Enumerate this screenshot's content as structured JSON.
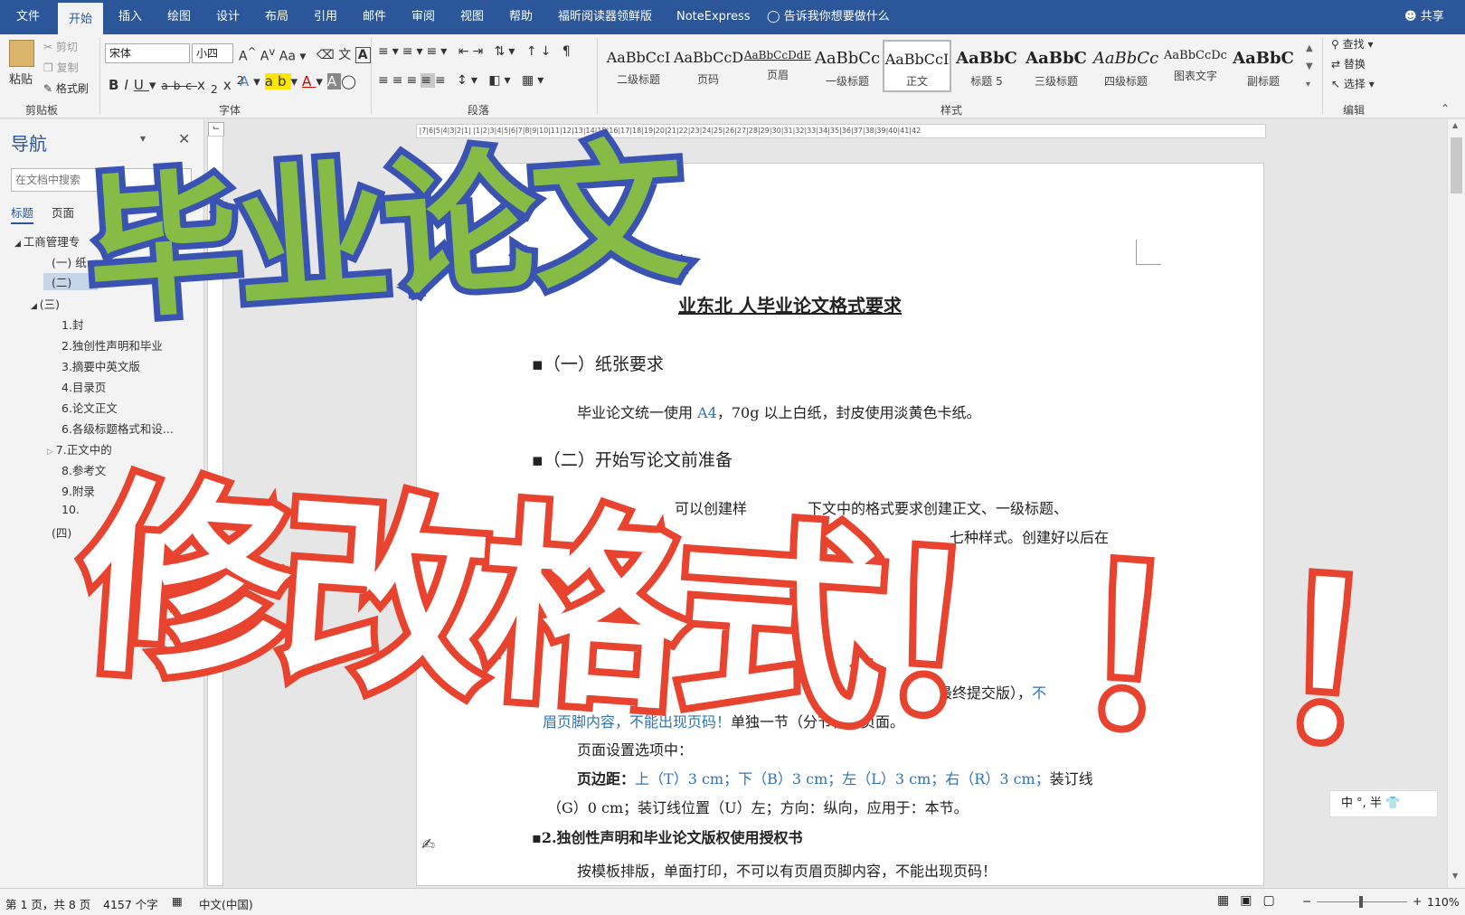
{
  "menubar": {
    "tabs": [
      "文件",
      "开始",
      "插入",
      "绘图",
      "设计",
      "布局",
      "引用",
      "邮件",
      "审阅",
      "视图",
      "帮助",
      "福昕阅读器领鲜版",
      "NoteExpress"
    ],
    "active_tab": "开始",
    "tell_me": "告诉我你想要做什么",
    "share": "共享"
  },
  "ribbon": {
    "clipboard": {
      "paste": "粘贴",
      "cut": "剪切",
      "copy": "复制",
      "format_painter": "格式刷",
      "group": "剪贴板"
    },
    "font": {
      "name": "宋体",
      "size": "小四",
      "group": "字体"
    },
    "paragraph": {
      "group": "段落"
    },
    "styles": {
      "group": "样式",
      "items": [
        {
          "sample": "AaBbCcI",
          "label": "二级标题"
        },
        {
          "sample": "AaBbCcD",
          "label": "页码"
        },
        {
          "sample": "AaBbCcDdE",
          "label": "页眉"
        },
        {
          "sample": "AaBbCc",
          "label": "一级标题"
        },
        {
          "sample": "AaBbCcI",
          "label": "正文"
        },
        {
          "sample": "AaBbC",
          "label": "标题 5"
        },
        {
          "sample": "AaBbC",
          "label": "三级标题"
        },
        {
          "sample": "AaBbCc",
          "label": "四级标题"
        },
        {
          "sample": "AaBbCcDc",
          "label": "图表文字"
        },
        {
          "sample": "AaBbC",
          "label": "副标题"
        }
      ],
      "selected": "正文"
    },
    "editing": {
      "find": "查找",
      "replace": "替换",
      "select": "选择",
      "group": "编辑"
    }
  },
  "nav": {
    "title": "导航",
    "search_placeholder": "在文档中搜索",
    "tabs": [
      "标题",
      "页面"
    ],
    "items": [
      "工商管理专",
      "(一) 纸",
      "(二)",
      "(三)",
      "1.封",
      "2.独创性声明和毕业",
      "3.摘要中英文版",
      "4.目录页",
      "6.论文正文",
      "6.各级标题格式和设...",
      "7.正文中的",
      "8.参考文",
      "9.附录",
      "10.",
      "(四)"
    ]
  },
  "document": {
    "title": "业东北  人毕业论文格式要求",
    "h1": "（一）纸张要求",
    "p1a": "毕业论文统一使用 ",
    "p1b": "A4",
    "p1c": "，70g 以上白纸，封皮使用淡黄色卡纸。",
    "h2": "（二）开始写论文前准备",
    "p2a": "可以创建样",
    "p2b": "下文中的格式要求创建正文、一级标题、",
    "p2c": "七种样式。创建好以后在",
    "p3a": "最终提交版），",
    "p3b": "不",
    "p4a": "眉页脚内容，不能出现页码！",
    "p4b": "单独一节（分节符）页面。",
    "p5": "页面设置选项中：",
    "p6a": "页边距：",
    "p6b": "上（T）3 cm；下（B）3 cm；左（L）3 cm；右（R）3 cm；",
    "p6c": "装订线",
    "p7": "（G）0 cm；装订线位置（U）左；方向：纵向，应用于：本节。",
    "h3": "2.独创性声明和毕业论文版权使用授权书",
    "p8": "按模板排版，单面打印，不可以有页眉页脚内容，不能出现页码！"
  },
  "overlay": {
    "line1": "毕业论文",
    "line2": "修改格式！！！"
  },
  "ime": "中 °, 半",
  "status": {
    "page": "第 1 页，共 8 页",
    "words": "4157 个字",
    "lang": "中文(中国)",
    "zoom": "110%"
  },
  "colors": {
    "brand": "#2b579a",
    "overlay_green": "#86bb45",
    "overlay_blue": "#3a53b3",
    "overlay_red": "#e8432e"
  }
}
